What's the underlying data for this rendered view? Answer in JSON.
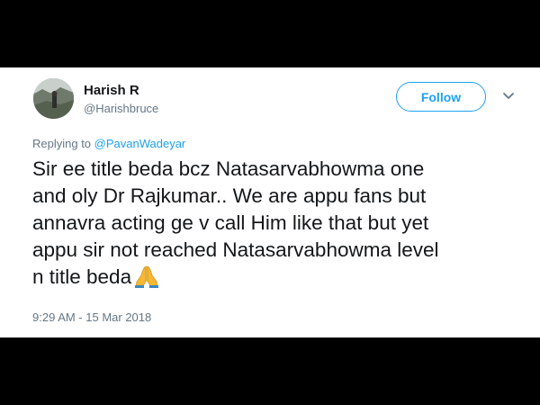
{
  "tweet": {
    "author": {
      "display_name": "Harish R",
      "handle": "@Harishbruce"
    },
    "follow_label": "Follow",
    "reply": {
      "prefix": "Replying to",
      "target": "@PavanWadeyar"
    },
    "text_lines": [
      "Sir ee title beda bcz Natasarvabhowma one",
      "and oly Dr Rajkumar.. We are appu fans but",
      "annavra acting ge v call Him like that but yet",
      "appu sir not reached Natasarvabhowma level",
      "n title beda"
    ],
    "emoji": "pray-emoji",
    "timestamp": "9:29 AM - 15 Mar 2018"
  },
  "colors": {
    "accent": "#1da1f2",
    "secondary_text": "#657786",
    "primary_text": "#14171a",
    "frame": "#000000",
    "emoji": "#f7b731"
  }
}
